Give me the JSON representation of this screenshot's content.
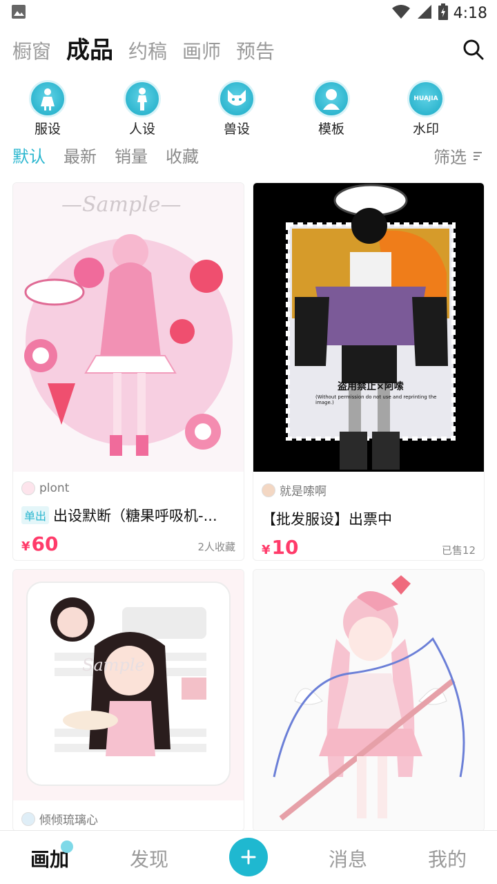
{
  "status_bar": {
    "time": "4:18"
  },
  "top_tabs": [
    "橱窗",
    "成品",
    "约稿",
    "画师",
    "预告"
  ],
  "active_top_tab": "成品",
  "categories": [
    {
      "label": "服设",
      "icon": "dress-figure-icon"
    },
    {
      "label": "人设",
      "icon": "person-figure-icon"
    },
    {
      "label": "兽设",
      "icon": "animal-face-icon"
    },
    {
      "label": "模板",
      "icon": "bust-template-icon"
    },
    {
      "label": "水印",
      "icon": "watermark-icon",
      "icon_text": "HUAJIA"
    }
  ],
  "sort_tabs": [
    "默认",
    "最新",
    "销量",
    "收藏"
  ],
  "active_sort": "默认",
  "filter_label": "筛选",
  "products": [
    {
      "author": "plont",
      "tag": "单出",
      "title": "出设默断（糖果呼吸机-...",
      "price": "60",
      "currency": "¥",
      "meta": "2人收藏",
      "image_text": "—Sample—"
    },
    {
      "author": "就是嗦啊",
      "tag": "",
      "title": "【批发服设】出票中",
      "price": "10",
      "currency": "¥",
      "meta": "已售12",
      "image_text": "盗用禁止×阿嗦",
      "image_subtext": "(Without permission do not use and reprinting the image.)"
    },
    {
      "author": "倾倾琉璃心",
      "tag": "",
      "title": "",
      "price": "",
      "currency": "",
      "meta": "",
      "image_text": "Sample"
    },
    {
      "author": "",
      "tag": "",
      "title": "",
      "price": "",
      "currency": "",
      "meta": "",
      "image_text": ""
    }
  ],
  "bottom_nav": [
    "画加",
    "发现",
    "消息",
    "我的"
  ],
  "active_nav": "画加",
  "colors": {
    "accent": "#2ab6cf",
    "price": "#ff3b6a",
    "add_button": "#1fb8d0"
  }
}
